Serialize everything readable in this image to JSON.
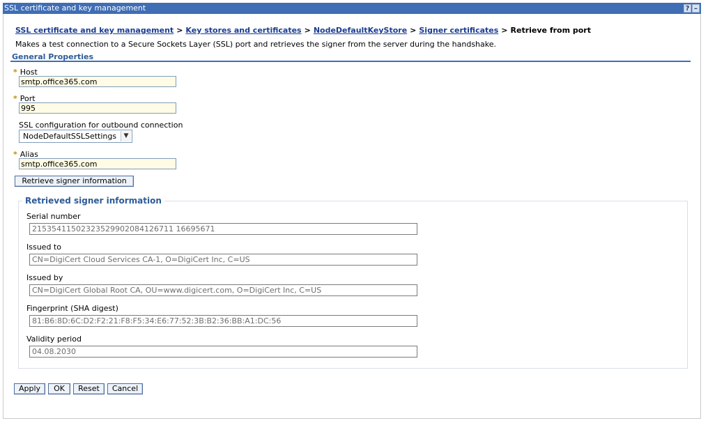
{
  "window": {
    "title": "SSL certificate and key management",
    "help_glyph": "?",
    "minimize_glyph": "–"
  },
  "breadcrumb": {
    "items": [
      "SSL certificate and key management",
      "Key stores and certificates",
      "NodeDefaultKeyStore",
      "Signer certificates"
    ],
    "current": "Retrieve from port",
    "separator": ">"
  },
  "description": "Makes a test connection to a Secure Sockets Layer (SSL) port and retrieves the signer from the server during the handshake.",
  "general_properties": {
    "title": "General Properties",
    "required_marker": "*",
    "host": {
      "label": "Host",
      "value": "smtp.office365.com"
    },
    "port": {
      "label": "Port",
      "value": "995"
    },
    "ssl_config": {
      "label": "SSL configuration for outbound connection",
      "value": "NodeDefaultSSLSettings"
    },
    "alias": {
      "label": "Alias",
      "value": "smtp.office365.com"
    },
    "retrieve_button": "Retrieve signer information"
  },
  "retrieved": {
    "title": "Retrieved signer information",
    "serial": {
      "label": "Serial number",
      "value": "21535411502323529902084126711 16695671"
    },
    "issued_to": {
      "label": "Issued to",
      "value": "CN=DigiCert Cloud Services CA-1, O=DigiCert Inc, C=US"
    },
    "issued_by": {
      "label": "Issued by",
      "value": "CN=DigiCert Global Root CA, OU=www.digicert.com, O=DigiCert Inc, C=US"
    },
    "fingerprint": {
      "label": "Fingerprint (SHA digest)",
      "value": "81:B6:8D:6C:D2:F2:21:F8:F5:34:E6:77:52:3B:B2:36:BB:A1:DC:56"
    },
    "validity": {
      "label": "Validity period",
      "value": "04.08.2030"
    }
  },
  "actions": {
    "apply": "Apply",
    "ok": "OK",
    "reset": "Reset",
    "cancel": "Cancel"
  },
  "colors": {
    "titlebar": "#3f6eb5",
    "link": "#1a3c91",
    "section_title": "#2d5b97",
    "required_input_bg": "#fffbe4"
  }
}
